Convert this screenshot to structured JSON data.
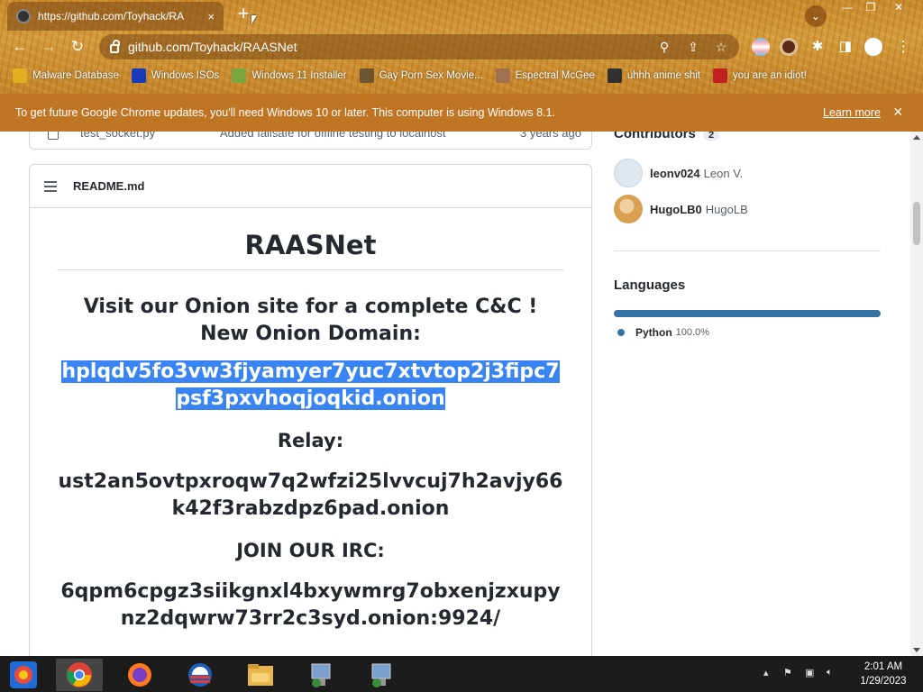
{
  "browser": {
    "tab_title": "https://github.com/Toyhack/RA",
    "tab_close": "×",
    "new_tab": "+",
    "url": "github.com/Toyhack/RAASNet",
    "bookmarks": [
      {
        "label": "Malware Database",
        "icon_color": "#e0b020"
      },
      {
        "label": "Windows ISOs",
        "icon_color": "#1a3bb8"
      },
      {
        "label": "Windows 11 Installer",
        "icon_color": "#7aa640"
      },
      {
        "label": "Gay Porn Sex Movie...",
        "icon_color": "#6a5530"
      },
      {
        "label": "Espectral McGee",
        "icon_color": "#a07050"
      },
      {
        "label": "uhhh anime shit",
        "icon_color": "#303030"
      },
      {
        "label": "you are an idiot!",
        "icon_color": "#c02020"
      }
    ]
  },
  "infobar": {
    "message": "To get future Google Chrome updates, you'll need Windows 10 or later. This computer is using Windows 8.1.",
    "link": "Learn more",
    "close": "×"
  },
  "repo": {
    "file_row": {
      "name": "test_socket.py",
      "message": "Added failsafe for offline testing to localhost",
      "age": "3 years ago"
    },
    "readme_filename": "README.md",
    "readme": {
      "title": "RAASNet",
      "visit_line1": "Visit our Onion site for a complete C&C !",
      "visit_line2": "New Onion Domain:",
      "onion_domain": "hplqdv5fo3vw3fjyamyer7yuc7xtvtop2j3fipc7psf3pxvhoqjoqkid.onion",
      "relay_heading": "Relay:",
      "relay_address": "ust2an5ovtpxroqw7q2wfzi25lvvcuj7h2avjy66k42f3rabzdpz6pad.onion",
      "irc_heading": "JOIN OUR IRC:",
      "irc_address": "6qpm6cpgz3siikgnxl4bxywmrg7obxenjzxupynz2dqwrw73rr2c3syd.onion:9924/"
    }
  },
  "sidebar": {
    "contributors_title": "Contributors",
    "contributors_count": "2",
    "contributors": [
      {
        "login": "leonv024",
        "name": "Leon V.",
        "avatar_color": "#dfe8ef"
      },
      {
        "login": "HugoLB0",
        "name": "HugoLB",
        "avatar_color": "#d8a050"
      }
    ],
    "languages_title": "Languages",
    "languages": [
      {
        "name": "Python",
        "percent": "100.0%",
        "color": "#3572a5",
        "fraction": 1.0
      }
    ]
  },
  "taskbar": {
    "time": "2:01 AM",
    "date": "1/29/2023"
  }
}
